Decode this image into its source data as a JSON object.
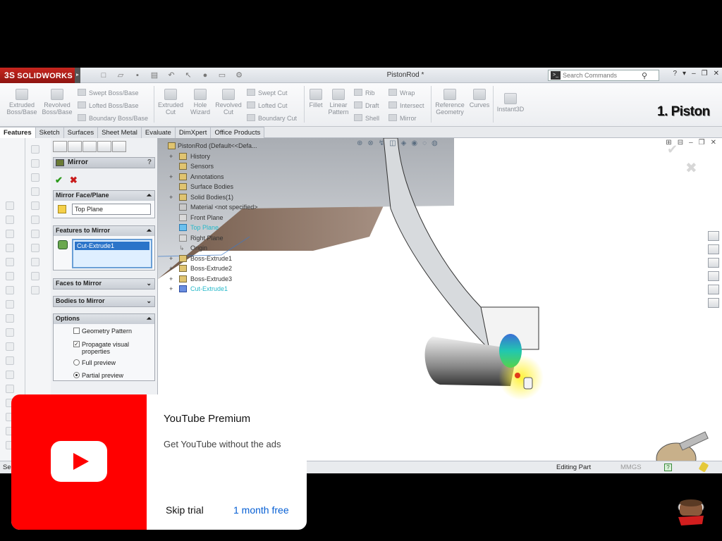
{
  "window": {
    "brand": "SOLIDWORKS",
    "brand_prefix": "3S",
    "doc_title": "PistonRod *",
    "search_placeholder": "Search Commands",
    "win_controls": [
      "?",
      "▾",
      "–",
      "❐",
      "✕"
    ]
  },
  "ribbon": {
    "groups": [
      {
        "label1": "Extruded",
        "label2": "Boss/Base"
      },
      {
        "label1": "Revolved",
        "label2": "Boss/Base"
      },
      {
        "label1": "Extruded",
        "label2": "Cut"
      },
      {
        "label1": "Hole",
        "label2": "Wizard"
      },
      {
        "label1": "Revolved",
        "label2": "Cut"
      },
      {
        "label1": "Fillet",
        "label2": ""
      },
      {
        "label1": "Linear",
        "label2": "Pattern"
      },
      {
        "label1": "Reference",
        "label2": "Geometry"
      },
      {
        "label1": "Curves",
        "label2": ""
      },
      {
        "label1": "Instant3D",
        "label2": ""
      }
    ],
    "small": {
      "swept_boss": "Swept Boss/Base",
      "lofted_boss": "Lofted Boss/Base",
      "boundary_boss": "Boundary Boss/Base",
      "swept_cut": "Swept Cut",
      "lofted_cut": "Lofted Cut",
      "boundary_cut": "Boundary Cut",
      "rib": "Rib",
      "draft": "Draft",
      "shell": "Shell",
      "wrap": "Wrap",
      "intersect": "Intersect",
      "mirror": "Mirror"
    }
  },
  "overlay_title": "1. Piston",
  "tabs": [
    "Features",
    "Sketch",
    "Surfaces",
    "Sheet Metal",
    "Evaluate",
    "DimXpert",
    "Office Products"
  ],
  "property_manager": {
    "title": "Mirror",
    "help": "?",
    "ok": "✔",
    "cancel": "✖",
    "mirror_face_header": "Mirror Face/Plane",
    "mirror_face_value": "Top Plane",
    "features_header": "Features to Mirror",
    "features_selected": "Cut-Extrude1",
    "faces_header": "Faces to Mirror",
    "bodies_header": "Bodies to Mirror",
    "options_header": "Options",
    "opt_geometry_pattern": "Geometry Pattern",
    "opt_propagate_1": "Propagate visual",
    "opt_propagate_2": "properties",
    "opt_full_preview": "Full preview",
    "opt_partial_preview": "Partial preview",
    "geometry_pattern_checked": false,
    "propagate_checked": true,
    "preview_mode": "Partial preview"
  },
  "feature_tree": {
    "root": "PistonRod  (Default<<Defa...",
    "items": [
      {
        "label": "History",
        "expand": "+"
      },
      {
        "label": "Sensors",
        "expand": ""
      },
      {
        "label": "Annotations",
        "expand": "+"
      },
      {
        "label": "Surface Bodies",
        "expand": ""
      },
      {
        "label": "Solid Bodies(1)",
        "expand": "+"
      },
      {
        "label": "Material <not specified>",
        "expand": ""
      },
      {
        "label": "Front Plane",
        "expand": ""
      },
      {
        "label": "Top Plane",
        "expand": ""
      },
      {
        "label": "Right Plane",
        "expand": ""
      },
      {
        "label": "Origin",
        "expand": ""
      },
      {
        "label": "Boss-Extrude1",
        "expand": "+"
      },
      {
        "label": "Boss-Extrude2",
        "expand": "+"
      },
      {
        "label": "Boss-Extrude3",
        "expand": "+"
      },
      {
        "label": "Cut-Extrude1",
        "expand": "+"
      }
    ],
    "highlighted": [
      "Top Plane",
      "Cut-Extrude1"
    ]
  },
  "status": {
    "left": "Sel",
    "mode": "Editing Part",
    "units": "MMGS"
  },
  "ad": {
    "title": "YouTube Premium",
    "subtitle": "Get YouTube without the ads",
    "skip": "Skip trial",
    "free": "1 month free"
  },
  "colors": {
    "brand_red": "#c8261f",
    "ad_red": "#ff0000",
    "link_blue": "#065fd4",
    "tree_highlight": "#25b8c9",
    "selection_blue": "#2b74c9"
  }
}
